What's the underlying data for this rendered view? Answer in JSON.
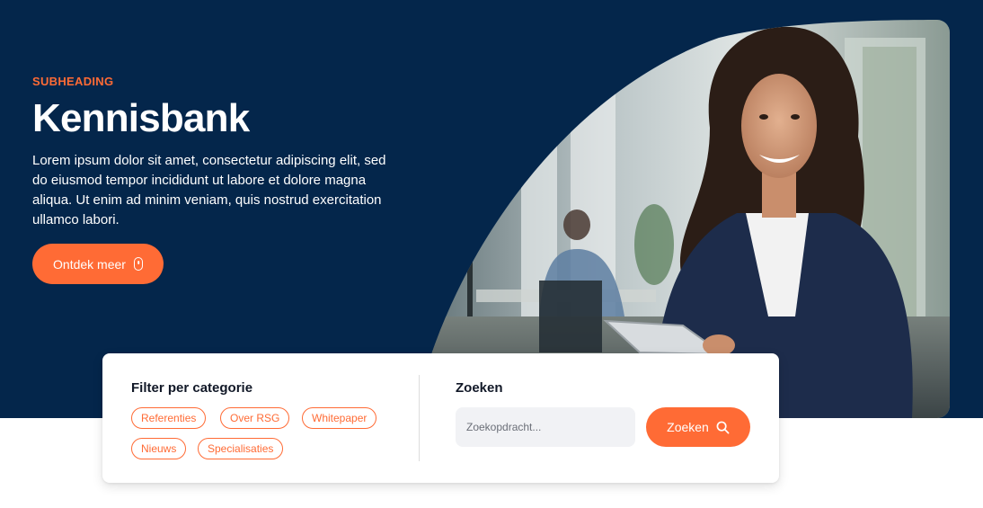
{
  "hero": {
    "subheading": "SUBHEADING",
    "title": "Kennisbank",
    "description": "Lorem ipsum dolor sit amet, consectetur adipiscing elit, sed do eiusmod tempor incididunt ut labore et dolore magna aliqua. Ut enim ad minim veniam, quis nostrud exercitation ullamco labori.",
    "cta_label": "Ontdek meer",
    "cta_icon": "mouse-scroll-icon"
  },
  "filter": {
    "heading": "Filter per categorie",
    "tags": [
      "Referenties",
      "Over RSG",
      "Whitepaper",
      "Nieuws",
      "Specialisaties"
    ]
  },
  "search": {
    "heading": "Zoeken",
    "placeholder": "Zoekopdracht...",
    "button_label": "Zoeken",
    "button_icon": "search-icon"
  },
  "colors": {
    "navy": "#04264b",
    "accent": "#ff6b35",
    "input_bg": "#f1f2f5"
  }
}
